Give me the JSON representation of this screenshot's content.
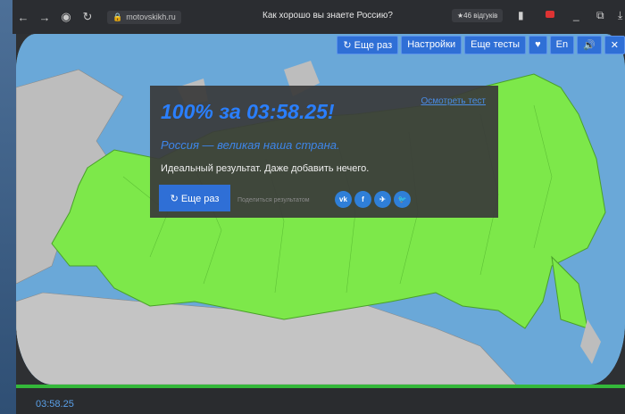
{
  "browser": {
    "url": "motovskikh.ru",
    "title": "Как хорошо вы знаете Россию?",
    "reviews": "★46 відгуків"
  },
  "toolbar": {
    "again": "↻ Еще раз",
    "settings": "Настройки",
    "more_tests": "Еще тесты",
    "language": "En"
  },
  "result": {
    "score": "100% за 03:58.25!",
    "review_link": "Осмотреть тест",
    "subtitle": "Россия — великая наша страна.",
    "message": "Идеальный результат. Даже добавить нечего.",
    "again_button": "↻ Еще раз",
    "share_label": "Поделиться результатом",
    "social": [
      "vk",
      "f",
      "✈",
      "🐦"
    ]
  },
  "progress": {
    "value": 1.0,
    "color": "#34b83a"
  },
  "timer": "03:58.25",
  "colors": {
    "accent": "#2f6fd6",
    "russia_fill": "#7de84a",
    "sea": "#6aa8d8",
    "land": "#bdbdbd"
  }
}
